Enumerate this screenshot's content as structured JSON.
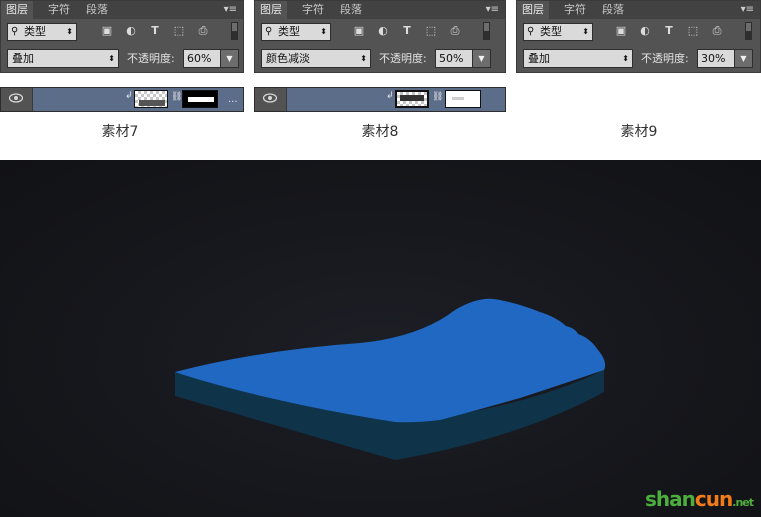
{
  "colors": {
    "panel_bg": "#535353",
    "tab_bar": "#424242",
    "layer_row": "#5c6d89",
    "scene_bg": "#16171c",
    "shape_top": "#2068c1",
    "shape_side": "#0f3349",
    "watermark_green": "#4cae3c",
    "watermark_orange": "#f07b17"
  },
  "panels": [
    {
      "tabs": [
        "图层",
        "字符",
        "段落"
      ],
      "menu_icon": "panel-menu-icon",
      "filter_label": "类型",
      "filter_icons": [
        "image-icon",
        "adjustment-icon",
        "text-icon",
        "shape-icon",
        "smart-object-icon"
      ],
      "blend_mode": "叠加",
      "opacity_label": "不透明度:",
      "opacity_value": "60%"
    },
    {
      "tabs": [
        "图层",
        "字符",
        "段落"
      ],
      "menu_icon": "panel-menu-icon",
      "filter_label": "类型",
      "filter_icons": [
        "image-icon",
        "adjustment-icon",
        "text-icon",
        "shape-icon",
        "smart-object-icon"
      ],
      "blend_mode": "颜色减淡",
      "opacity_label": "不透明度:",
      "opacity_value": "50%"
    },
    {
      "tabs": [
        "图层",
        "字符",
        "段落"
      ],
      "menu_icon": "panel-menu-icon",
      "filter_label": "类型",
      "filter_icons": [
        "image-icon",
        "adjustment-icon",
        "text-icon",
        "shape-icon",
        "smart-object-icon"
      ],
      "blend_mode": "叠加",
      "opacity_label": "不透明度:",
      "opacity_value": "30%"
    }
  ],
  "layer_rows": [
    {
      "visibility_icon": "eye-icon",
      "more": "..."
    },
    {
      "visibility_icon": "eye-icon",
      "more": "..."
    }
  ],
  "captions": [
    "素材7",
    "素材8",
    "素材9"
  ],
  "watermark": {
    "part1": "shan",
    "part2": "cun",
    "suffix": ".net"
  }
}
